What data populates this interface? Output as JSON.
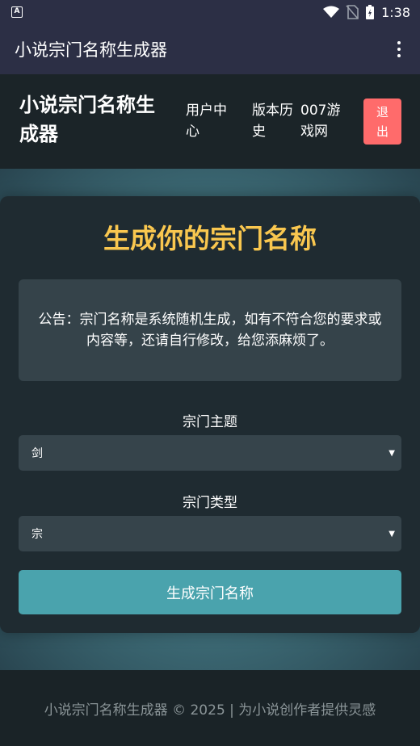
{
  "status_bar": {
    "notif_letter": "A",
    "time": "1:38"
  },
  "app_bar": {
    "title": "小说宗门名称生成器",
    "more_icon": "more-vert-icon"
  },
  "site_header": {
    "title_line1": "小说宗门名称生",
    "title_line2": "成器",
    "nav": {
      "user_center_l1": "用户中",
      "user_center_l2": "心",
      "history_l1": "版本历",
      "history_l2": "史",
      "site007_l1": "007游",
      "site007_l2": "戏网"
    },
    "logout_l1": "退",
    "logout_l2": "出"
  },
  "card": {
    "title": "生成你的宗门名称",
    "notice": "公告：宗门名称是系统随机生成，如有不符合您的要求或内容等，还请自行修改，给您添麻烦了。",
    "theme_label": "宗门主题",
    "theme_value": "剑",
    "type_label": "宗门类型",
    "type_value": "宗",
    "generate_button": "生成宗门名称"
  },
  "footer": {
    "text": "小说宗门名称生成器 © 2025 | 为小说创作者提供灵感"
  },
  "colors": {
    "title_gold": "#f9c74f",
    "logout_red": "#ff6b6b",
    "button_teal": "#4aa3ad"
  }
}
